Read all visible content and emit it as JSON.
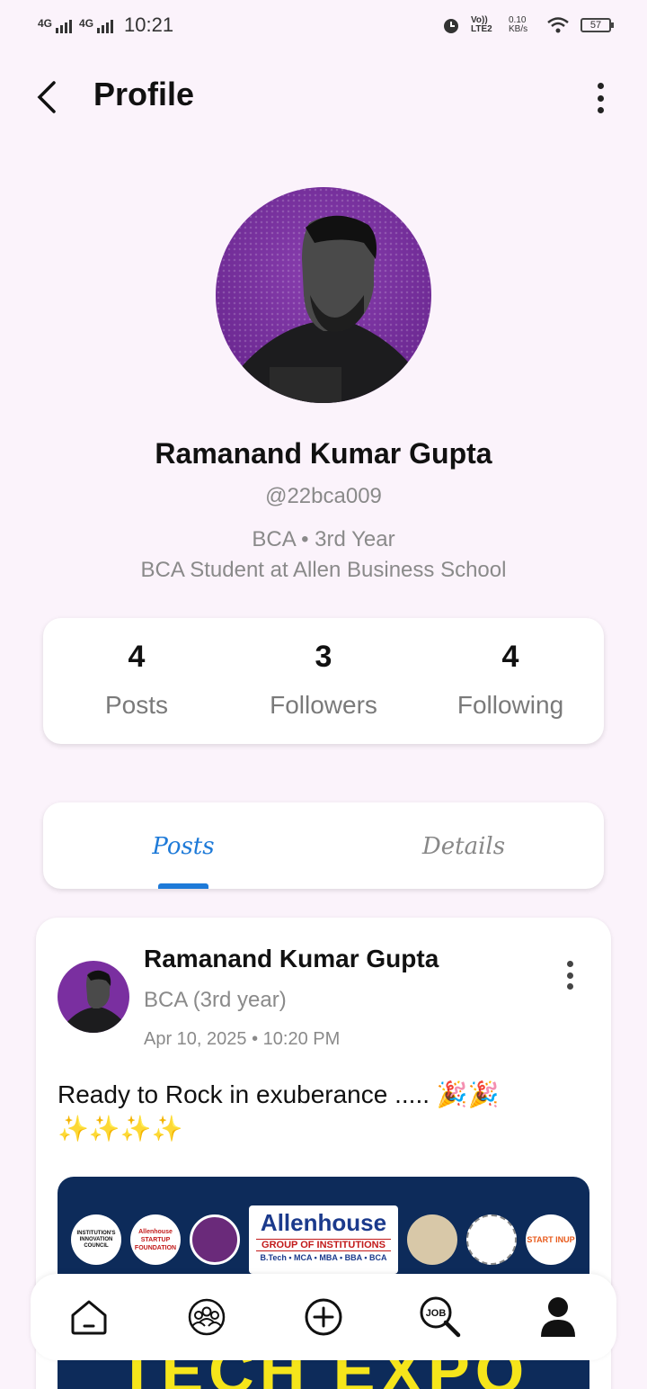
{
  "status_bar": {
    "net1": "4G",
    "net2": "4G",
    "time": "10:21",
    "volte": "Vo)) LTE2",
    "speed": "0.10 KB/s",
    "battery": "57"
  },
  "header": {
    "title": "Profile"
  },
  "profile": {
    "name": "Ramanand Kumar Gupta",
    "handle": "@22bca009",
    "course": "BCA • 3rd Year",
    "bio": "BCA Student at Allen Business School"
  },
  "stats": [
    {
      "value": "4",
      "label": "Posts"
    },
    {
      "value": "3",
      "label": "Followers"
    },
    {
      "value": "4",
      "label": "Following"
    }
  ],
  "tabs": [
    {
      "label": "Posts",
      "active": true
    },
    {
      "label": "Details",
      "active": false
    }
  ],
  "post": {
    "author": "Ramanand Kumar Gupta",
    "course": "BCA (3rd year)",
    "time": "Apr 10, 2025 • 10:20 PM",
    "text": "Ready to Rock in exuberance ..... 🎉🎉 ✨✨✨✨",
    "image": {
      "org_name": "Allenhouse",
      "org_sub": "GROUP OF INSTITUTIONS",
      "courses": "B.Tech • MCA • MBA • BBA • BCA",
      "logo1": "INSTITUTION'S INNOVATION COUNCIL",
      "logo2": "Allenhouse STARTUP FOUNDATION",
      "logo5": "START INUP",
      "banner": "TECH EXPO"
    }
  },
  "bottom_nav": [
    {
      "icon": "home-icon"
    },
    {
      "icon": "community-icon"
    },
    {
      "icon": "add-post-icon"
    },
    {
      "icon": "job-search-icon",
      "label": "JOB"
    },
    {
      "icon": "profile-icon"
    }
  ],
  "colors": {
    "background": "#fbf3fb",
    "accent": "#1e7ad8",
    "avatar_bg": "#6e2a94",
    "banner_bg": "#0d2b5a",
    "banner_text": "#f5e51b"
  }
}
